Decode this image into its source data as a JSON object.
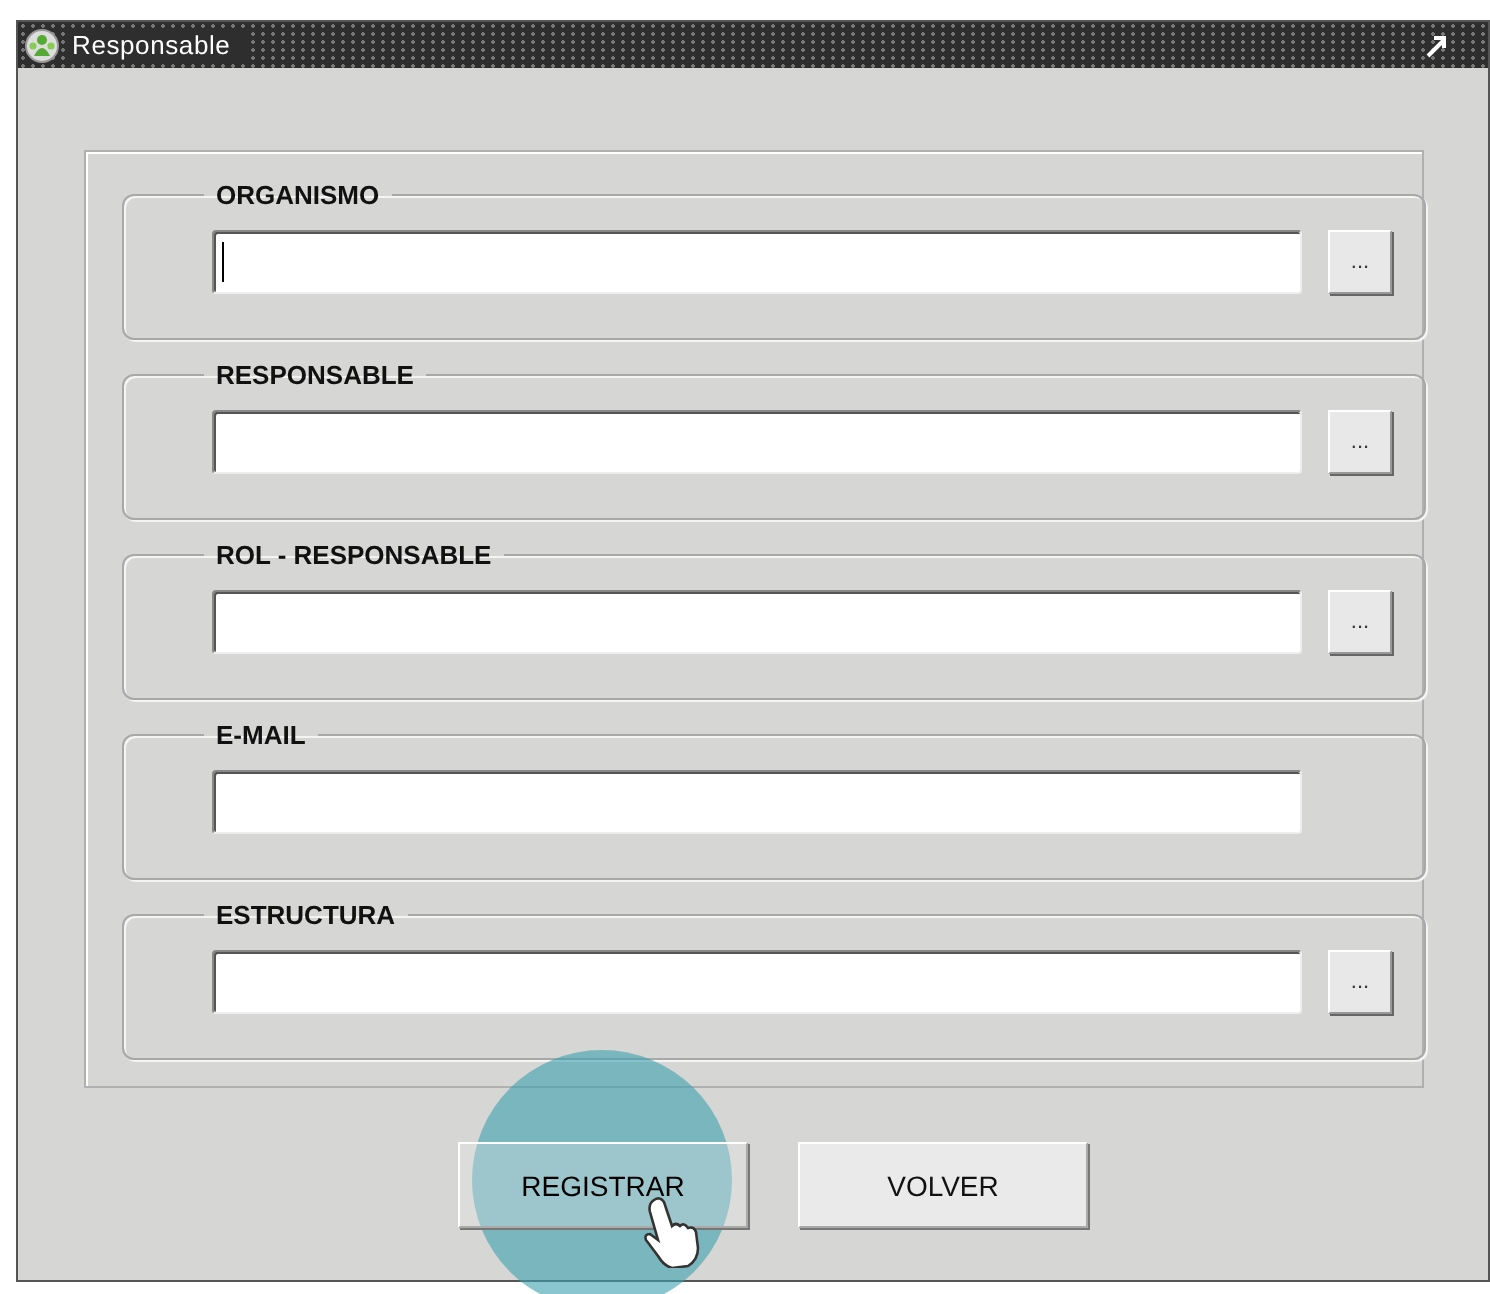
{
  "window": {
    "title": "Responsable"
  },
  "groups": [
    {
      "label": "ORGANISMO",
      "kind": "lookup",
      "focused": true,
      "lookup_button": "..."
    },
    {
      "label": "RESPONSABLE",
      "kind": "lookup",
      "focused": false,
      "lookup_button": "..."
    },
    {
      "label": "ROL - RESPONSABLE",
      "kind": "lookup",
      "focused": false,
      "lookup_button": "..."
    },
    {
      "label": "E-MAIL",
      "kind": "plain",
      "focused": false
    },
    {
      "label": "ESTRUCTURA",
      "kind": "lookup",
      "focused": false,
      "lookup_button": "..."
    }
  ],
  "buttons": [
    {
      "label": "REGISTRAR",
      "clicked": true
    },
    {
      "label": "VOLVER",
      "clicked": false
    }
  ]
}
